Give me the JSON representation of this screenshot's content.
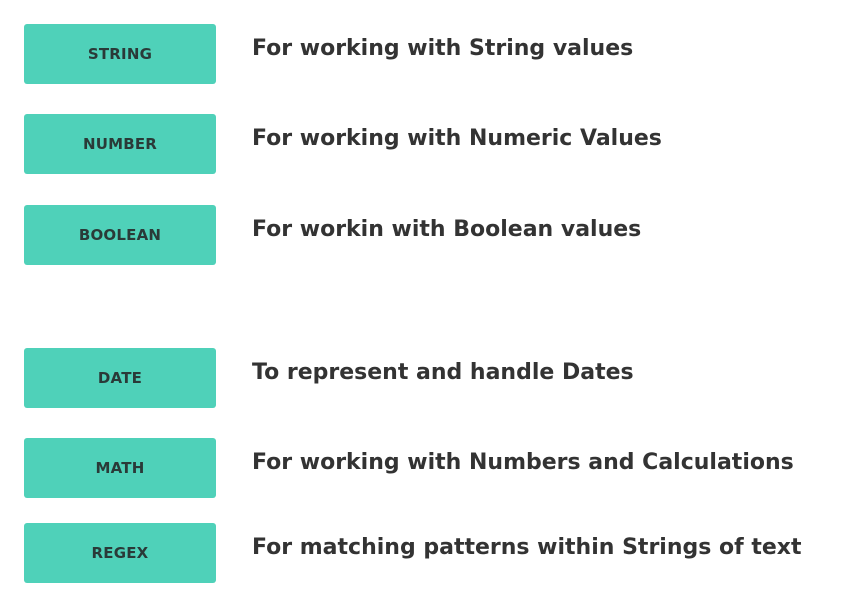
{
  "accent": "#4fd1b9",
  "items": [
    {
      "label": "STRING",
      "description": "For working with String values"
    },
    {
      "label": "NUMBER",
      "description": "For working with Numeric Values"
    },
    {
      "label": "BOOLEAN",
      "description": "For workin with Boolean values"
    },
    {
      "label": "DATE",
      "description": "To represent and handle Dates"
    },
    {
      "label": "MATH",
      "description": "For working with Numbers and Calculations"
    },
    {
      "label": "REGEX",
      "description": "For matching patterns within Strings of text"
    }
  ]
}
